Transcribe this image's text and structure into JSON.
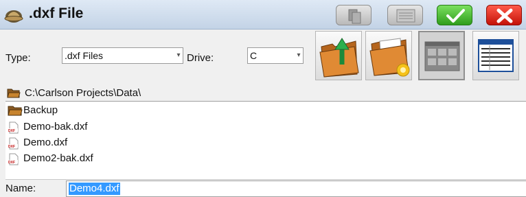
{
  "window": {
    "title": ".dxf File"
  },
  "toolbar": {
    "buttons": [
      {
        "name": "copy-button",
        "icon": "copy-icon"
      },
      {
        "name": "list-button",
        "icon": "list-icon"
      },
      {
        "name": "ok-button",
        "icon": "checkmark-icon",
        "color": "#3cb62a"
      },
      {
        "name": "cancel-button",
        "icon": "close-icon",
        "color": "#e0241a"
      }
    ]
  },
  "filters": {
    "type_label": "Type:",
    "type_value": ".dxf Files",
    "drive_label": "Drive:",
    "drive_value": "C"
  },
  "actions": {
    "up_folder_icon": "folder-up-icon",
    "new_folder_icon": "folder-new-icon",
    "icon_view_icon": "icon-view-icon",
    "list_view_icon": "list-view-icon"
  },
  "path": {
    "current": "C:\\Carlson Projects\\Data\\"
  },
  "files": [
    {
      "name": "Backup",
      "kind": "folder"
    },
    {
      "name": "Demo-bak.dxf",
      "kind": "dxf"
    },
    {
      "name": "Demo.dxf",
      "kind": "dxf"
    },
    {
      "name": "Demo2-bak.dxf",
      "kind": "dxf"
    }
  ],
  "name_field": {
    "label": "Name:",
    "value": "Demo4.dxf"
  }
}
